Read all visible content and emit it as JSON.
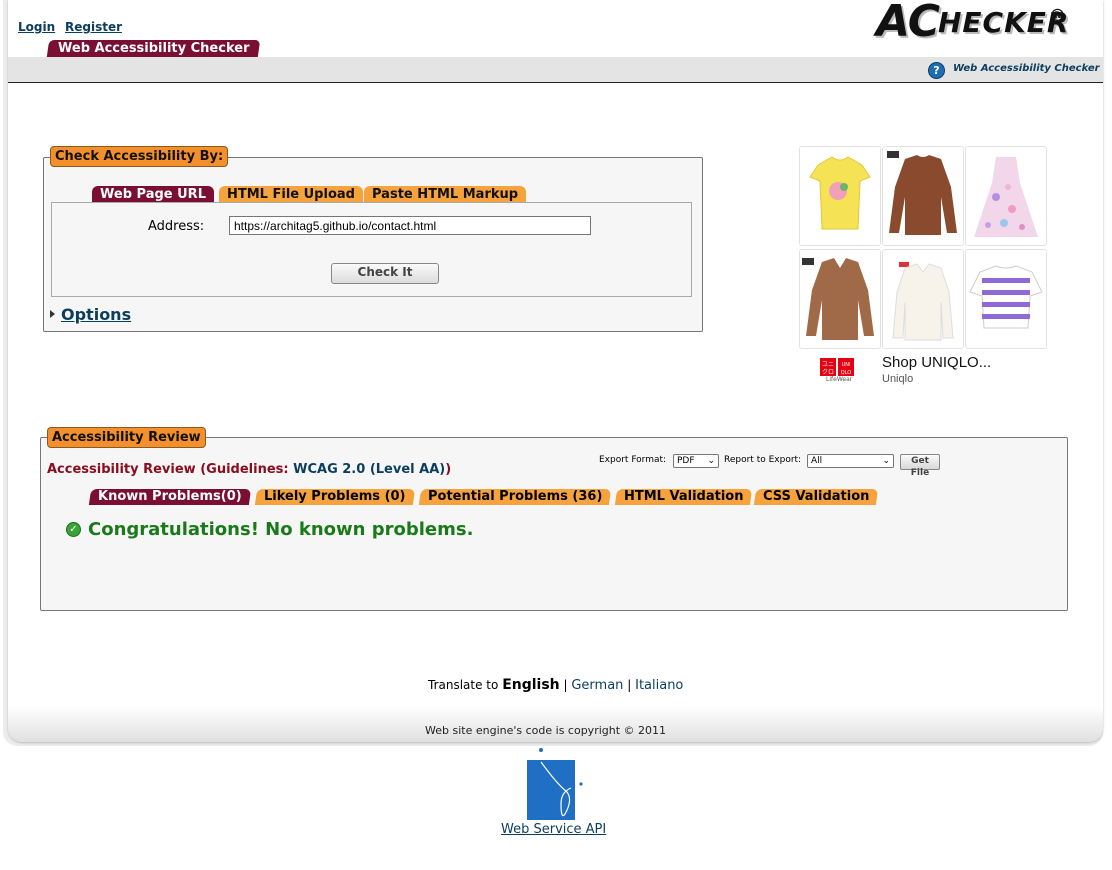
{
  "header": {
    "login": "Login",
    "register": "Register",
    "logo_first": "AC",
    "logo_rest": "HECKER",
    "logo_mark": "®",
    "main_tab": "Web Accessibility Checker",
    "help_text": "Web Accessibility Checker",
    "help_icon": "question-circle-icon"
  },
  "check": {
    "legend": "Check Accessibility By:",
    "tabs": [
      "Web Page URL",
      "HTML File Upload",
      "Paste HTML Markup"
    ],
    "active_tab": "Web Page URL",
    "address_label": "Address:",
    "address_value": "https://architag5.github.io/contact.html",
    "check_button": "Check It",
    "options_link": "Options"
  },
  "ad": {
    "title": "Shop UNIQLO...",
    "brand": "Uniqlo",
    "logo_caption": "LifeWear",
    "products": [
      "yellow-tshirt",
      "brown-sweater",
      "floral-dress",
      "brown-polo-sweater",
      "white-shirt",
      "purple-striped-top"
    ]
  },
  "review": {
    "legend": "Accessibility Review",
    "heading_prefix": "Accessibility Review (Guidelines: ",
    "guideline_link": "WCAG 2.0 (Level AA)",
    "heading_suffix": ")",
    "tabs": [
      "Known Problems(0)",
      "Likely Problems (0)",
      "Potential Problems (36)",
      "HTML Validation",
      "CSS Validation"
    ],
    "active_tab": "Known Problems(0)",
    "export_format_label": "Export Format:",
    "export_format_value": "PDF",
    "report_label": "Report to Export:",
    "report_value": "All",
    "get_file": "Get File",
    "congrats": "Congratulations! No known problems."
  },
  "footer": {
    "translate_label": "Translate to",
    "current_language": "English",
    "languages": [
      "German",
      "Italiano"
    ],
    "separator": "|",
    "copyright": "Web site engine's code is copyright © 2011",
    "api_link": "Web Service API"
  },
  "colors": {
    "active_tab": "#7b0f33",
    "inactive_tab": "#f6a23d",
    "legend": "#f4902c",
    "link": "#0b3d5e",
    "success": "#1a7a1a",
    "heading_red": "#8b0c1e"
  }
}
